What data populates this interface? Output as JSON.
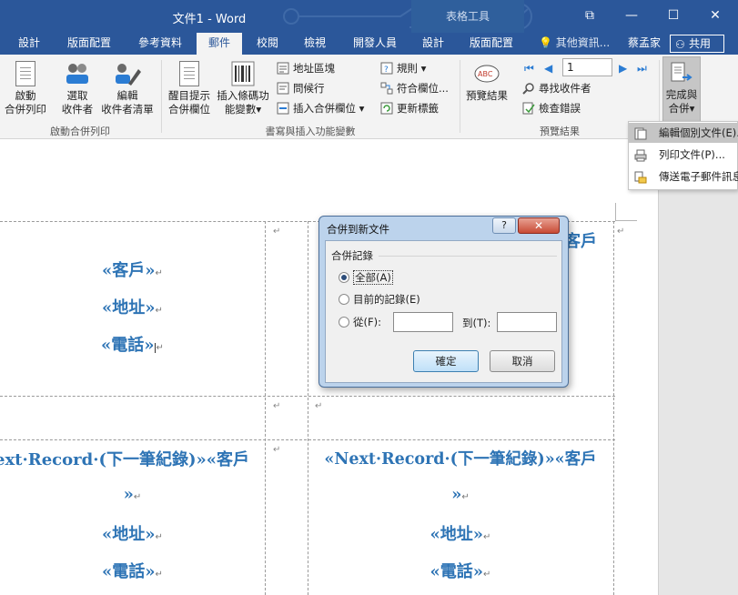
{
  "window": {
    "title": "文件1 - Word",
    "context_title": "表格工具",
    "buttons": {
      "restore": "⧉",
      "minimize": "—",
      "maximize": "☐",
      "close": "✕"
    }
  },
  "tabs": [
    {
      "label": "設計"
    },
    {
      "label": "版面配置"
    },
    {
      "label": "參考資料"
    },
    {
      "label": "郵件"
    },
    {
      "label": "校閱"
    },
    {
      "label": "檢視"
    },
    {
      "label": "開發人員"
    },
    {
      "label": "設計"
    },
    {
      "label": "版面配置"
    }
  ],
  "tell_me": "其他資訊...",
  "user_name": "蔡孟家",
  "share_label": "共用",
  "ribbon": {
    "start_group": {
      "label": "啟動合併列印",
      "start_btn": [
        "啟動",
        "合併列印"
      ],
      "select_btn": [
        "選取",
        "收件者"
      ],
      "edit_btn": [
        "編輯",
        "收件者清單"
      ]
    },
    "fields_group": {
      "label": "書寫與插入功能變數",
      "highlight_btn": [
        "醒目提示",
        "合併欄位"
      ],
      "barcode_btn": [
        "插入條碼功",
        "能變數"
      ],
      "address_block": "地址區塊",
      "greeting_line": "問候行",
      "insert_merge_field": "插入合併欄位",
      "rules": "規則",
      "match_fields": "符合欄位...",
      "update_labels": "更新標籤"
    },
    "preview_group": {
      "label": "預覽結果",
      "preview_btn": "預覽結果",
      "record_number": "1",
      "find_recipient": "尋找收件者",
      "check_errors": "檢查錯誤"
    },
    "finish_group": {
      "finish_btn": [
        "完成與",
        "合併"
      ]
    }
  },
  "finish_menu": {
    "items": [
      {
        "label": "編輯個別文件(E)..."
      },
      {
        "label": "列印文件(P)..."
      },
      {
        "label": "傳送電子郵件訊息..."
      }
    ]
  },
  "document": {
    "cell1": [
      "«客戶»",
      "«地址»",
      "«電話»"
    ],
    "cell2_partial": "客戶",
    "cell3": [
      "ext·Record·(下一筆紀錄)»«客戶",
      "»",
      "«地址»",
      "«電話»"
    ],
    "cell4": [
      "«Next·Record·(下一筆紀錄)»«客戶",
      "»",
      "«地址»",
      "«電話»"
    ],
    "para_mark": "↵",
    "cell_mark": "↵"
  },
  "dialog": {
    "title": "合併到新文件",
    "help": "?",
    "close": "✕",
    "group_label": "合併記錄",
    "options": {
      "all": "全部(A)",
      "current": "目前的記錄(E)",
      "from": "從(F):",
      "to": "到(T):"
    },
    "ok": "確定",
    "cancel": "取消"
  },
  "colors": {
    "title_blue": "#2b579a",
    "merge_field_blue": "#2e74b5",
    "ribbon_bg": "#f3f3f3"
  }
}
